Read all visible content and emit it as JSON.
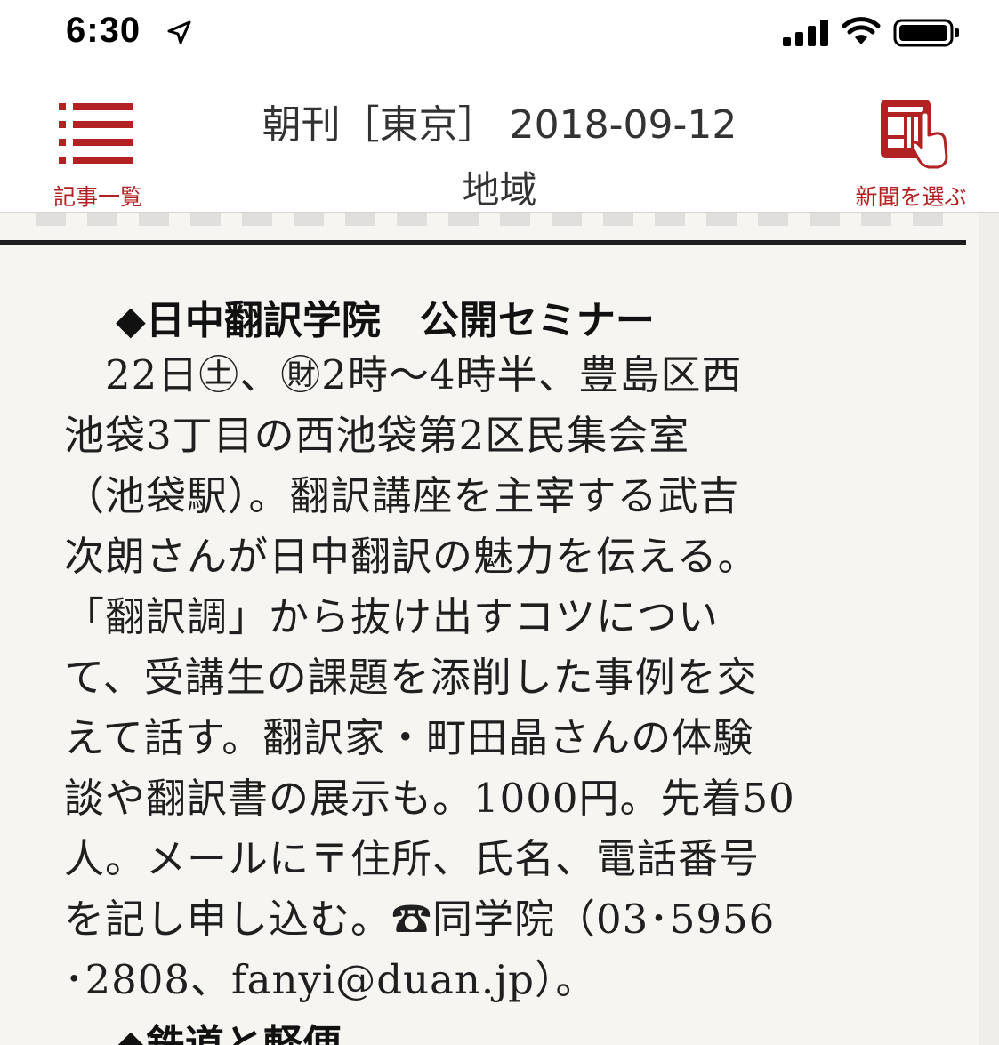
{
  "status_bar": {
    "time": "6:30",
    "location_icon": "location-arrow-icon",
    "signal_icon": "cellular-signal-icon",
    "wifi_icon": "wifi-icon",
    "battery_icon": "battery-icon"
  },
  "header": {
    "menu_label": "記事一覧",
    "menu_icon": "list-icon",
    "edition": "朝刊［東京］ 2018-09-12",
    "section": "地域",
    "select_label": "新聞を選ぶ",
    "select_icon": "newspaper-tap-icon",
    "accent_color": "#b32222"
  },
  "article": {
    "headline": "◆日中翻訳学院　公開セミナー",
    "lines": [
      "　22日㊏、㊖2時〜4時半、豊島区西",
      "池袋3丁目の西池袋第2区民集会室",
      "（池袋駅）。翻訳講座を主宰する武吉",
      "次朗さんが日中翻訳の魅力を伝える。",
      "「翻訳調」から抜け出すコツについ",
      "て、受講生の課題を添削した事例を交",
      "えて話す。翻訳家・町田晶さんの体験",
      "談や翻訳書の展示も。1000円。先着50",
      "人。メールに〒住所、氏名、電話番号",
      "を記し申し込む。☎同学院（03･5956",
      "･2808、fanyi@duan.jp）。"
    ],
    "next_headline": "◆鉄道と軽便"
  }
}
